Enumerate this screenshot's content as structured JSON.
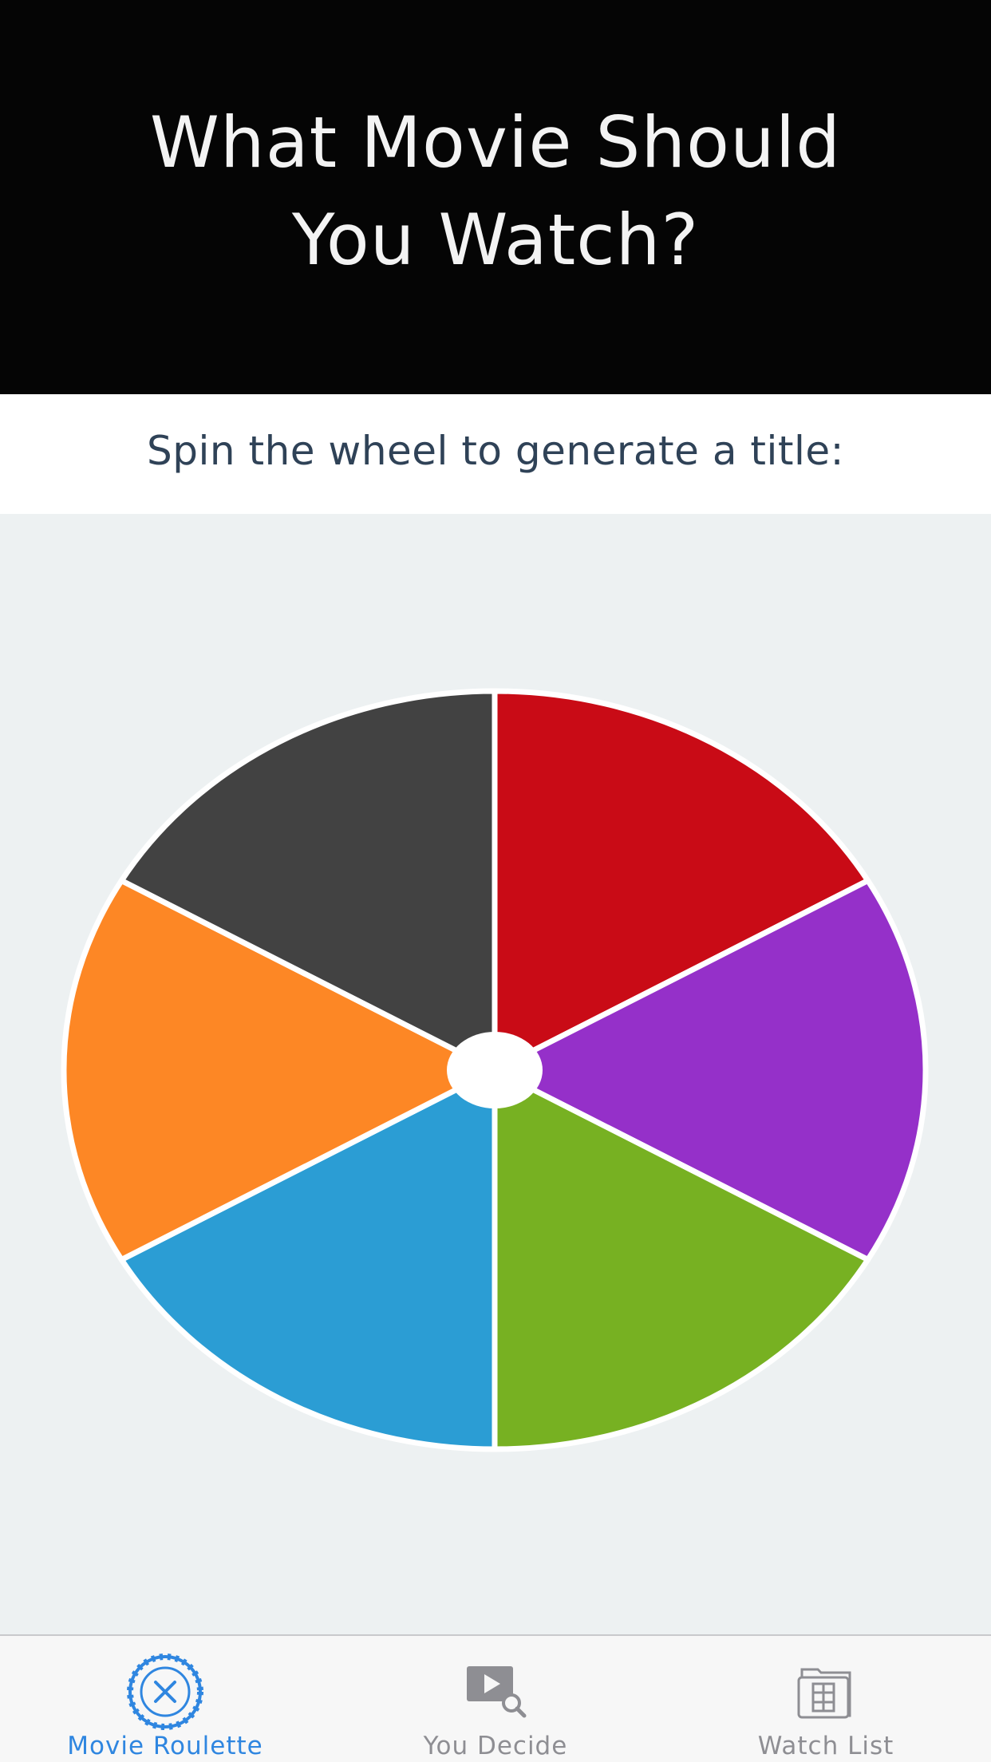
{
  "header": {
    "title": "What Movie Should You Watch?"
  },
  "subtitle": "Spin the wheel to generate a title:",
  "wheel": {
    "segment_colors": [
      "#c90b16",
      "#9530c9",
      "#77b122",
      "#2b9dd4",
      "#fd8725",
      "#424242"
    ],
    "hub_color": "#ffffff",
    "divider_color": "#ffffff"
  },
  "tabbar": {
    "tabs": [
      {
        "label": "Movie Roulette",
        "icon": "roulette-icon",
        "active": true
      },
      {
        "label": "You Decide",
        "icon": "video-search-icon",
        "active": false
      },
      {
        "label": "Watch List",
        "icon": "film-folder-icon",
        "active": false
      }
    ],
    "active_color": "#2f86e0",
    "inactive_color": "#8e8e93"
  }
}
